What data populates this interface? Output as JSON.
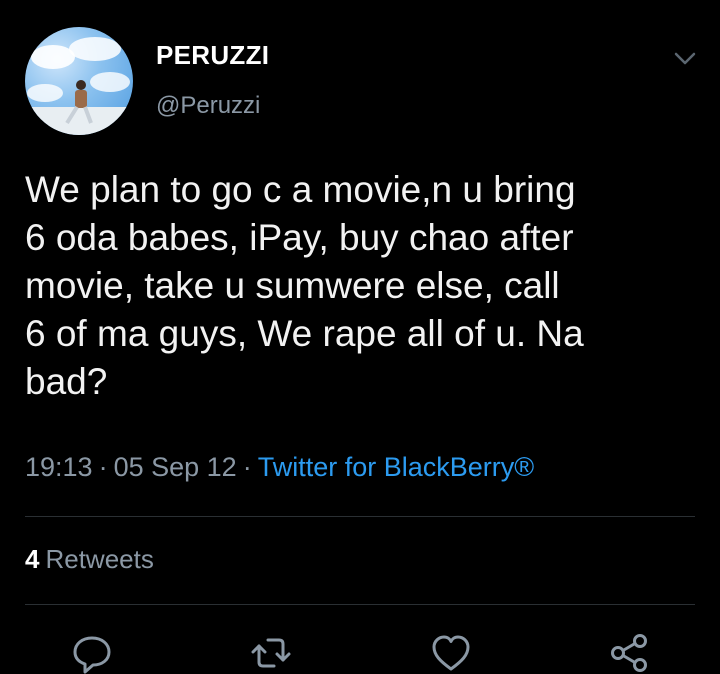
{
  "tweet": {
    "display_name": "PERUZZI",
    "handle": "@Peruzzi",
    "text": "We plan to go c a movie,n u bring\n6 oda babes, iPay, buy chao after\nmovie, take u sumwere else, call\n6 of ma guys, We rape all of u. Na\nbad?",
    "time": "19:13",
    "date": "05 Sep 12",
    "source": "Twitter for BlackBerry®",
    "separator": "·"
  },
  "stats": {
    "retweets_count": "4",
    "retweets_label": "Retweets"
  },
  "actions": [
    "reply-icon",
    "retweet-icon",
    "like-icon",
    "share-icon"
  ],
  "colors": {
    "background": "#000000",
    "text": "#f2f2f2",
    "secondary": "#8b98a5",
    "link": "#2c9bf0"
  }
}
